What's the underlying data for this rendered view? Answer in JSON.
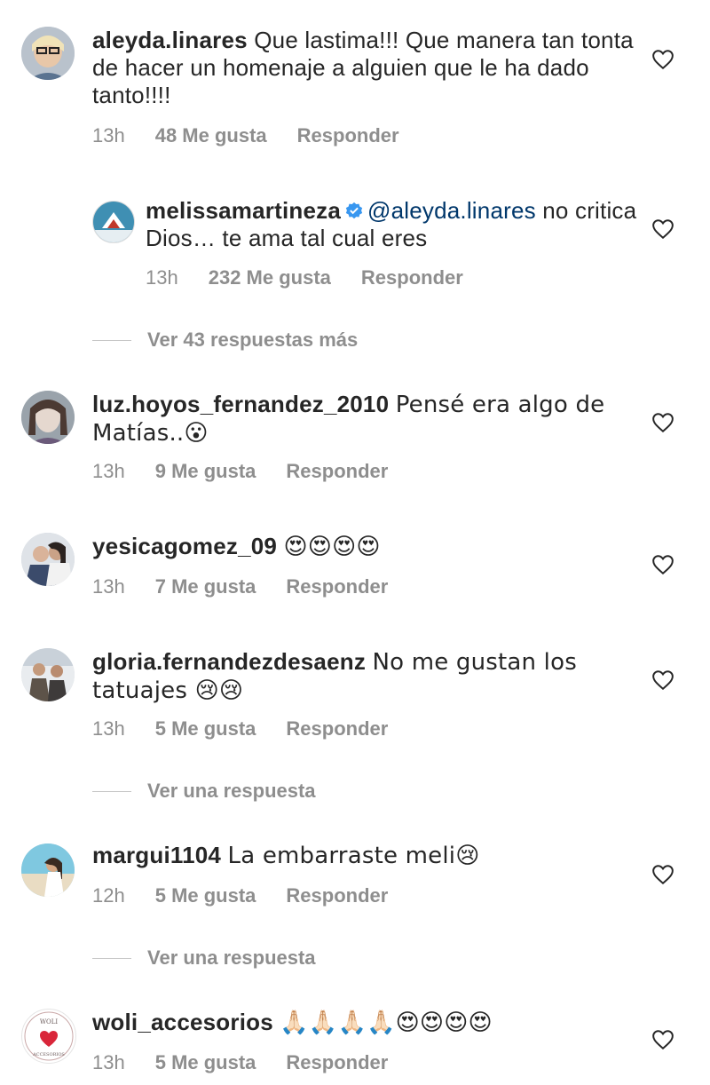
{
  "comments": [
    {
      "username": "aleyda.linares",
      "text": "Que lastima!!! Que manera tan tonta de hacer un homenaje a alguien que le ha dado tanto!!!!",
      "time": "13h",
      "likes": "48 Me gusta",
      "reply": "Responder"
    },
    {
      "username": "melissamartineza",
      "mention": "@aleyda.linares",
      "text": " no critica Dios… te ama tal cual eres",
      "time": "13h",
      "likes": "232 Me gusta",
      "reply": "Responder",
      "verified": true
    },
    {
      "username": "luz.hoyos_fernandez_2010",
      "text": "Pensé era algo de Matías..😮",
      "time": "13h",
      "likes": "9 Me gusta",
      "reply": "Responder"
    },
    {
      "username": "yesicagomez_09",
      "text": "😍😍😍😍",
      "time": "13h",
      "likes": "7 Me gusta",
      "reply": "Responder"
    },
    {
      "username": "gloria.fernandezdesaenz",
      "text": "No me gustan los tatuajes 😢😢",
      "time": "13h",
      "likes": "5 Me gusta",
      "reply": "Responder"
    },
    {
      "username": "margui1104",
      "text": "La embarraste meli😢",
      "time": "12h",
      "likes": "5 Me gusta",
      "reply": "Responder"
    },
    {
      "username": "woli_accesorios",
      "text": "🙏🏻🙏🏻🙏🏻🙏🏻😍😍😍😍",
      "time": "13h",
      "likes": "5 Me gusta",
      "reply": "Responder"
    }
  ],
  "view_more": {
    "first": "Ver 43 respuestas más",
    "second": "Ver una respuesta",
    "third": "Ver una respuesta"
  },
  "avatar_logo_text": "WOLI ACCESORIOS",
  "icons": {
    "heart": "heart-outline-icon",
    "verified": "verified-badge-icon"
  },
  "colors": {
    "text": "#262626",
    "secondary": "#8e8e8e",
    "mention": "#00376b",
    "verified": "#3897f0"
  }
}
